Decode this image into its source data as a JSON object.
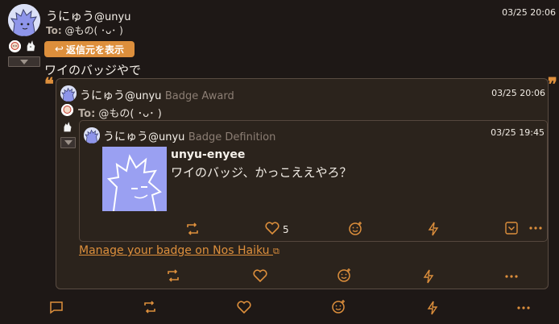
{
  "post": {
    "author_name": "うにゅう",
    "author_handle": "@unyu",
    "time": "03/25 20:06",
    "to_label": "To:",
    "to_mention": "@もの( ･ᴗ･ )",
    "show_reply_button": "返信元を表示",
    "content": "ワイのバッジやで"
  },
  "quoted": {
    "author_name": "うにゅう",
    "author_handle": "@unyu",
    "kind": "Badge Award",
    "time": "03/25 20:06",
    "to_label": "To:",
    "to_mention": "@もの( ･ᴗ･ )",
    "manage_link": "Manage your badge on Nos Haiku"
  },
  "definition": {
    "author_name": "うにゅう",
    "author_handle": "@unyu",
    "kind": "Badge Definition",
    "time": "03/25 19:45",
    "badge_name": "unyu-enyee",
    "badge_description": "ワイのバッジ、かっこええやろ？",
    "like_count": "5"
  },
  "colors": {
    "background": "#1e1816",
    "accent": "#dd8f3c",
    "card": "#2b231c"
  }
}
